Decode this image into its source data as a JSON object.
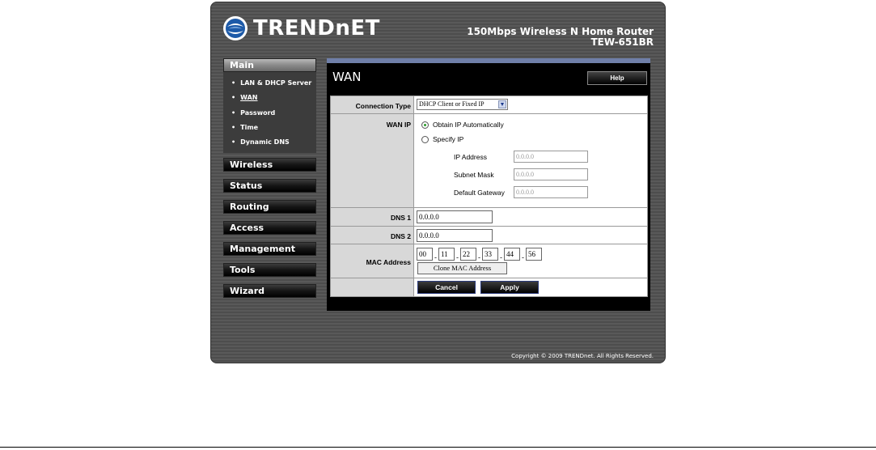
{
  "brand": {
    "name": "TRENDnET"
  },
  "header": {
    "product_line1": "150Mbps Wireless N Home Router",
    "product_line2": "TEW-651BR"
  },
  "sidebar": {
    "main_label": "Main",
    "subitems": [
      {
        "label": "LAN & DHCP Server"
      },
      {
        "label": "WAN"
      },
      {
        "label": "Password"
      },
      {
        "label": "Time"
      },
      {
        "label": "Dynamic DNS"
      }
    ],
    "menus": [
      {
        "label": "Wireless"
      },
      {
        "label": "Status"
      },
      {
        "label": "Routing"
      },
      {
        "label": "Access"
      },
      {
        "label": "Management"
      },
      {
        "label": "Tools"
      },
      {
        "label": "Wizard"
      }
    ]
  },
  "page": {
    "title": "WAN",
    "help_label": "Help"
  },
  "form": {
    "connection_type": {
      "label": "Connection Type",
      "value": "DHCP Client or Fixed IP"
    },
    "wan_ip": {
      "label": "WAN IP",
      "obtain_label": "Obtain IP Automatically",
      "specify_label": "Specify IP",
      "ip_address_label": "IP Address",
      "ip_address_value": "0.0.0.0",
      "subnet_mask_label": "Subnet Mask",
      "subnet_mask_value": "0.0.0.0",
      "gateway_label": "Default Gateway",
      "gateway_value": "0.0.0.0"
    },
    "dns1": {
      "label": "DNS 1",
      "value": "0.0.0.0"
    },
    "dns2": {
      "label": "DNS 2",
      "value": "0.0.0.0"
    },
    "mac": {
      "label": "MAC Address",
      "octets": [
        "00",
        "11",
        "22",
        "33",
        "44",
        "56"
      ],
      "clone_label": "Clone MAC Address"
    },
    "cancel_label": "Cancel",
    "apply_label": "Apply"
  },
  "footer": {
    "copyright": "Copyright © 2009 TRENDnet. All Rights Reserved."
  },
  "colors": {
    "frame": "#555555",
    "accent_bar": "#6f7fa8",
    "radio_selected": "#2a9c2a"
  }
}
